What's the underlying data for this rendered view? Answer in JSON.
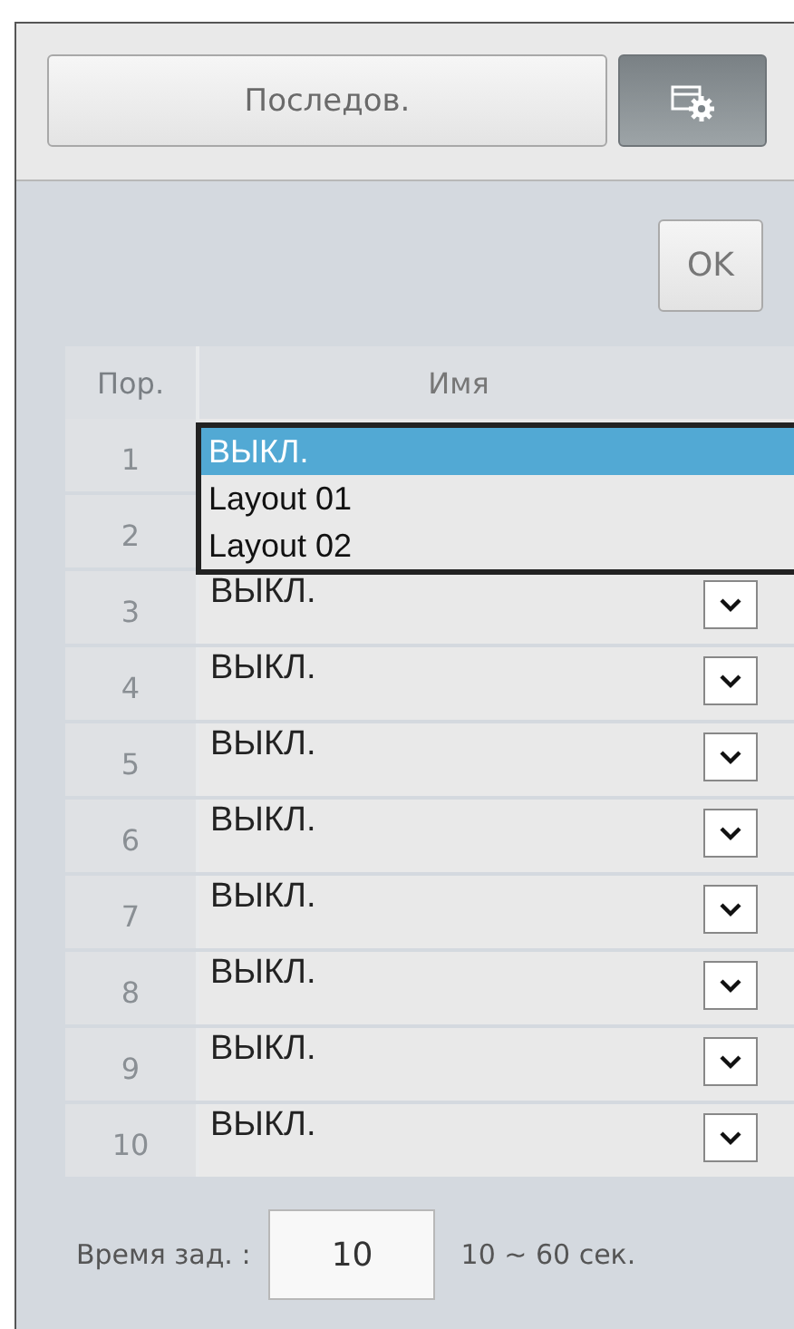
{
  "toolbar": {
    "sequence_button": "Последов.",
    "settings_button": {
      "selected": true
    }
  },
  "ok_button": "OK",
  "table": {
    "columns": [
      "Пор.",
      "Имя"
    ],
    "rows": [
      {
        "order": "1",
        "name": null,
        "expanded": true
      },
      {
        "order": "2",
        "name": null,
        "expanded": false
      },
      {
        "order": "3",
        "name": "ВЫКЛ.",
        "expanded": false
      },
      {
        "order": "4",
        "name": "ВЫКЛ.",
        "expanded": false
      },
      {
        "order": "5",
        "name": "ВЫКЛ.",
        "expanded": false
      },
      {
        "order": "6",
        "name": "ВЫКЛ.",
        "expanded": false
      },
      {
        "order": "7",
        "name": "ВЫКЛ.",
        "expanded": false
      },
      {
        "order": "8",
        "name": "ВЫКЛ.",
        "expanded": false
      },
      {
        "order": "9",
        "name": "ВЫКЛ.",
        "expanded": false
      },
      {
        "order": "10",
        "name": "ВЫКЛ.",
        "expanded": false
      }
    ]
  },
  "dropdown": {
    "options": [
      {
        "label": "ВЫКЛ.",
        "selected": true
      },
      {
        "label": "Layout 01",
        "selected": false
      },
      {
        "label": "Layout 02",
        "selected": false
      }
    ]
  },
  "dwell": {
    "label": "Время зад. :",
    "value": "10",
    "range": "10 ~ 60 сек."
  }
}
